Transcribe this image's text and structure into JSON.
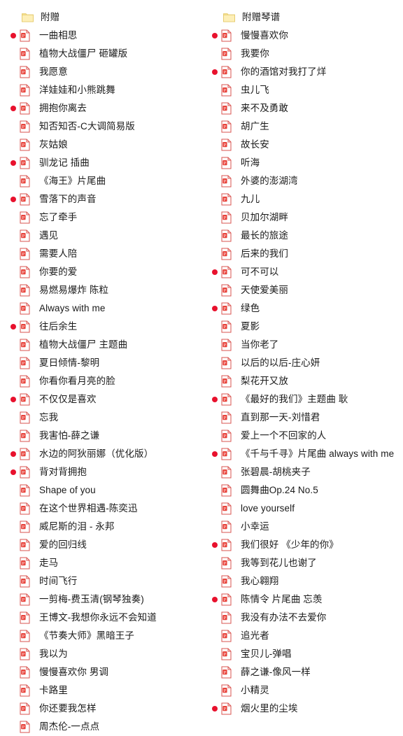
{
  "view": {
    "type": "file-listing",
    "columns": 2,
    "accent_color": "#e8112d",
    "folder_icon_color": "#fde89a",
    "file_icon_color": "#e8443c",
    "text_color": "#1a1a1a",
    "background": "#ffffff"
  },
  "icons": {
    "folder": "folder-icon",
    "file": "pdf-file-icon",
    "marker": "red-dot-marker-icon"
  },
  "columns": [
    {
      "header": {
        "label": "附赠",
        "icon": "folder-icon"
      },
      "items": [
        {
          "label": "一曲相思",
          "marked": true
        },
        {
          "label": "植物大战僵尸 砸罐版",
          "marked": false
        },
        {
          "label": "我愿意",
          "marked": false
        },
        {
          "label": "洋娃娃和小熊跳舞",
          "marked": false
        },
        {
          "label": "拥抱你离去",
          "marked": true
        },
        {
          "label": "知否知否-C大调简易版",
          "marked": false
        },
        {
          "label": "灰姑娘",
          "marked": false
        },
        {
          "label": "驯龙记 插曲",
          "marked": true
        },
        {
          "label": "《海王》片尾曲",
          "marked": false
        },
        {
          "label": "雪落下的声音",
          "marked": true
        },
        {
          "label": "忘了牵手",
          "marked": false
        },
        {
          "label": "遇见",
          "marked": false
        },
        {
          "label": "需要人陪",
          "marked": false
        },
        {
          "label": "你要的爱",
          "marked": false
        },
        {
          "label": "易燃易爆炸 陈粒",
          "marked": false
        },
        {
          "label": "Always with me",
          "marked": false
        },
        {
          "label": "往后余生",
          "marked": true
        },
        {
          "label": "植物大战僵尸 主题曲",
          "marked": false
        },
        {
          "label": "夏日倾情-黎明",
          "marked": false
        },
        {
          "label": "你看你看月亮的脸",
          "marked": false
        },
        {
          "label": "不仅仅是喜欢",
          "marked": true
        },
        {
          "label": "忘我",
          "marked": false
        },
        {
          "label": "我害怕-薛之谦",
          "marked": false
        },
        {
          "label": "水边的阿狄丽娜（优化版）",
          "marked": true
        },
        {
          "label": "背对背拥抱",
          "marked": true
        },
        {
          "label": "Shape of you",
          "marked": false
        },
        {
          "label": "在这个世界相遇-陈奕迅",
          "marked": false
        },
        {
          "label": "威尼斯的泪 - 永邦",
          "marked": false
        },
        {
          "label": "爱的回归线",
          "marked": false
        },
        {
          "label": "走马",
          "marked": false
        },
        {
          "label": "时间飞行",
          "marked": false
        },
        {
          "label": "一剪梅-费玉清(钢琴独奏)",
          "marked": false
        },
        {
          "label": "王博文-我想你永远不会知道",
          "marked": false
        },
        {
          "label": "《节奏大师》黑暗王子",
          "marked": false
        },
        {
          "label": "我以为",
          "marked": false
        },
        {
          "label": "慢慢喜欢你 男调",
          "marked": false
        },
        {
          "label": "卡路里",
          "marked": false
        },
        {
          "label": "你还要我怎样",
          "marked": false
        },
        {
          "label": "周杰伦-一点点",
          "marked": false
        }
      ]
    },
    {
      "header": {
        "label": "附赠琴谱",
        "icon": "folder-icon"
      },
      "items": [
        {
          "label": "慢慢喜欢你",
          "marked": true
        },
        {
          "label": "我要你",
          "marked": false
        },
        {
          "label": "你的酒馆对我打了烊",
          "marked": true
        },
        {
          "label": "虫儿飞",
          "marked": false
        },
        {
          "label": "来不及勇敢",
          "marked": false
        },
        {
          "label": "胡广生",
          "marked": false
        },
        {
          "label": "故长安",
          "marked": false
        },
        {
          "label": "听海",
          "marked": false
        },
        {
          "label": "外婆的澎湖湾",
          "marked": false
        },
        {
          "label": "九儿",
          "marked": false
        },
        {
          "label": "贝加尔湖畔",
          "marked": false
        },
        {
          "label": "最长的旅途",
          "marked": false
        },
        {
          "label": "后来的我们",
          "marked": false
        },
        {
          "label": "可不可以",
          "marked": true
        },
        {
          "label": "天使爱美丽",
          "marked": false
        },
        {
          "label": "绿色",
          "marked": true
        },
        {
          "label": "夏影",
          "marked": false
        },
        {
          "label": "当你老了",
          "marked": false
        },
        {
          "label": "以后的以后-庄心妍",
          "marked": false
        },
        {
          "label": "梨花开又放",
          "marked": false
        },
        {
          "label": "《最好的我们》主题曲 耿",
          "marked": true
        },
        {
          "label": "直到那一天-刘惜君",
          "marked": false
        },
        {
          "label": "爱上一个不回家的人",
          "marked": false
        },
        {
          "label": "《千与千寻》片尾曲 always with me",
          "marked": true
        },
        {
          "label": "张碧晨-胡桃夹子",
          "marked": false
        },
        {
          "label": "圆舞曲Op.24 No.5",
          "marked": false
        },
        {
          "label": "love yourself",
          "marked": false
        },
        {
          "label": "小幸运",
          "marked": false
        },
        {
          "label": "我们很好 《少年的你》",
          "marked": true
        },
        {
          "label": "我等到花儿也谢了",
          "marked": false
        },
        {
          "label": "我心翱翔",
          "marked": false
        },
        {
          "label": "陈情令 片尾曲 忘羡",
          "marked": true
        },
        {
          "label": "我没有办法不去爱你",
          "marked": false
        },
        {
          "label": "追光者",
          "marked": false
        },
        {
          "label": "宝贝儿-弹唱",
          "marked": false
        },
        {
          "label": "薛之谦-像风一样",
          "marked": false
        },
        {
          "label": "小精灵",
          "marked": false
        },
        {
          "label": "烟火里的尘埃",
          "marked": true
        }
      ]
    }
  ]
}
